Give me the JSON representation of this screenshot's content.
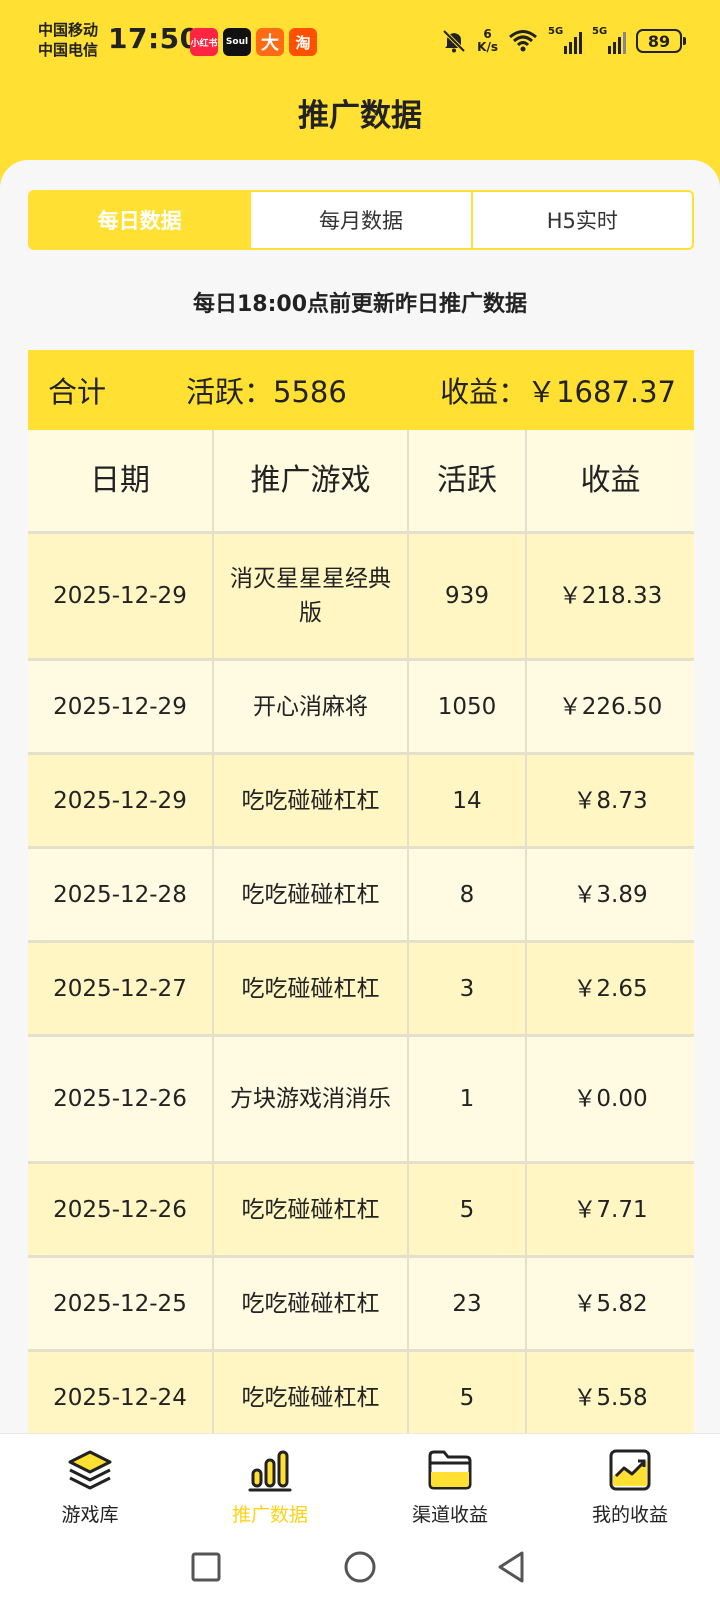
{
  "status_bar": {
    "carrier_1": "中国移动",
    "carrier_2": "中国电信",
    "time": "17:50",
    "apps": [
      "小红书",
      "Soul",
      "大",
      "淘"
    ],
    "net_speed_value": "6",
    "net_speed_unit": "K/s",
    "sim1_label": "5G",
    "sim2_label": "5G",
    "battery": "89"
  },
  "header": {
    "title": "推广数据"
  },
  "tabs": [
    {
      "label": "每日数据",
      "active": true
    },
    {
      "label": "每月数据",
      "active": false
    },
    {
      "label": "H5实时",
      "active": false
    }
  ],
  "notice": "每日18:00点前更新昨日推广数据",
  "summary": {
    "label": "合计",
    "active": "活跃：5586",
    "income": "收益：￥1687.37"
  },
  "table": {
    "headers": [
      "日期",
      "推广游戏",
      "活跃",
      "收益"
    ],
    "rows": [
      {
        "date": "2025-12-29",
        "game": "消灭星星星经典版",
        "active": "939",
        "income": "￥218.33"
      },
      {
        "date": "2025-12-29",
        "game": "开心消麻将",
        "active": "1050",
        "income": "￥226.50"
      },
      {
        "date": "2025-12-29",
        "game": "吃吃碰碰杠杠",
        "active": "14",
        "income": "￥8.73"
      },
      {
        "date": "2025-12-28",
        "game": "吃吃碰碰杠杠",
        "active": "8",
        "income": "￥3.89"
      },
      {
        "date": "2025-12-27",
        "game": "吃吃碰碰杠杠",
        "active": "3",
        "income": "￥2.65"
      },
      {
        "date": "2025-12-26",
        "game": "方块游戏消消乐",
        "active": "1",
        "income": "￥0.00"
      },
      {
        "date": "2025-12-26",
        "game": "吃吃碰碰杠杠",
        "active": "5",
        "income": "￥7.71"
      },
      {
        "date": "2025-12-25",
        "game": "吃吃碰碰杠杠",
        "active": "23",
        "income": "￥5.82"
      },
      {
        "date": "2025-12-24",
        "game": "吃吃碰碰杠杠",
        "active": "5",
        "income": "￥5.58"
      }
    ]
  },
  "bottom_nav": [
    {
      "label": "游戏库",
      "icon": "layers-icon",
      "active": false
    },
    {
      "label": "推广数据",
      "icon": "bar-chart-icon",
      "active": true
    },
    {
      "label": "渠道收益",
      "icon": "folder-icon",
      "active": false
    },
    {
      "label": "我的收益",
      "icon": "trend-chart-icon",
      "active": false
    }
  ],
  "colors": {
    "accent": "#ffe033",
    "active_nav": "#ffd21a"
  }
}
